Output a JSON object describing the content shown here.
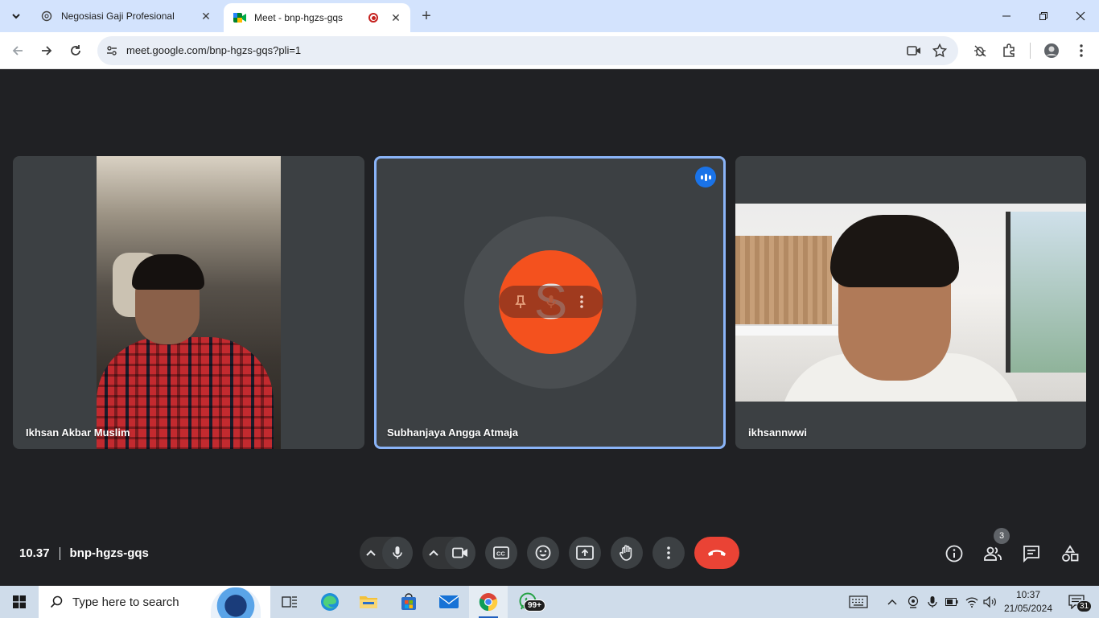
{
  "browser": {
    "tabs": [
      {
        "title": "Negosiasi Gaji Profesional",
        "active": false
      },
      {
        "title": "Meet - bnp-hgzs-gqs",
        "active": true
      }
    ],
    "url": "meet.google.com/bnp-hgzs-gqs?pli=1"
  },
  "meet": {
    "time": "10.37",
    "meeting_code": "bnp-hgzs-gqs",
    "participants": [
      {
        "name": "Ikhsan Akbar Muslim",
        "speaking": false
      },
      {
        "name": "Subhanjaya Angga Atmaja",
        "speaking": true,
        "avatar_letter": "S",
        "avatar_color": "#f4511e"
      },
      {
        "name": "ikhsannwwi",
        "speaking": false
      }
    ],
    "people_count": "3",
    "colors": {
      "leave": "#ea4335",
      "speaking_border": "#8ab4f8",
      "background": "#202124"
    }
  },
  "taskbar": {
    "search_placeholder": "Type here to search",
    "whatsapp_badge": "99+",
    "clock_time": "10:37",
    "clock_date": "21/05/2024",
    "notification_count": "31"
  }
}
